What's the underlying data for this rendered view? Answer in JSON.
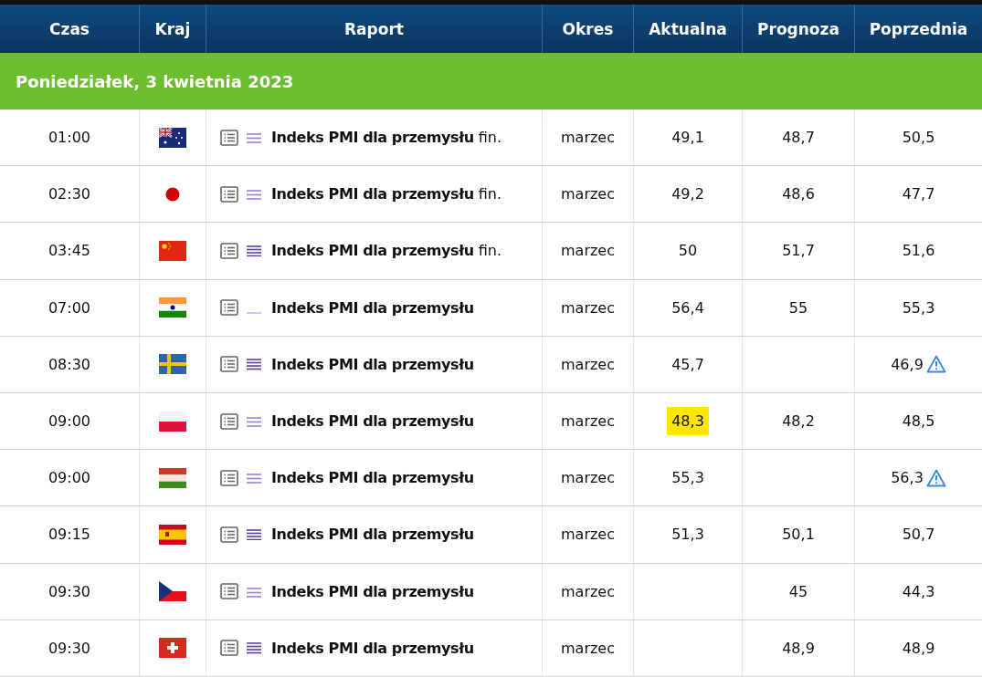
{
  "columns": [
    "Czas",
    "Kraj",
    "Raport",
    "Okres",
    "Aktualna",
    "Prognoza",
    "Poprzednia"
  ],
  "day_header": "Poniedziałek, 3 kwietnia 2023",
  "rows": [
    {
      "time": "01:00",
      "flag": {
        "kind": "australia"
      },
      "importance": {
        "kind": "medium"
      },
      "title": "Indeks PMI dla przemysłu",
      "suffix": "fin.",
      "period": "marzec",
      "actual": "49,1",
      "highlighted": false,
      "forecast": "48,7",
      "previous": "50,5",
      "revised": false
    },
    {
      "time": "02:30",
      "flag": {
        "kind": "japan"
      },
      "importance": {
        "kind": "medium"
      },
      "title": "Indeks PMI dla przemysłu",
      "suffix": "fin.",
      "period": "marzec",
      "actual": "49,2",
      "highlighted": false,
      "forecast": "48,6",
      "previous": "47,7",
      "revised": false
    },
    {
      "time": "03:45",
      "flag": {
        "kind": "china"
      },
      "importance": {
        "kind": "high"
      },
      "title": "Indeks PMI dla przemysłu",
      "suffix": "fin.",
      "period": "marzec",
      "actual": "50",
      "highlighted": false,
      "forecast": "51,7",
      "previous": "51,6",
      "revised": false
    },
    {
      "time": "07:00",
      "flag": {
        "kind": "india"
      },
      "importance": {
        "kind": "low"
      },
      "title": "Indeks PMI dla przemysłu",
      "period": "marzec",
      "actual": "56,4",
      "highlighted": false,
      "forecast": "55",
      "previous": "55,3",
      "revised": false
    },
    {
      "time": "08:30",
      "flag": {
        "kind": "sweden"
      },
      "importance": {
        "kind": "high"
      },
      "title": "Indeks PMI dla przemysłu",
      "period": "marzec",
      "actual": "45,7",
      "highlighted": false,
      "previous": "46,9",
      "revised": true
    },
    {
      "time": "09:00",
      "flag": {
        "kind": "poland"
      },
      "importance": {
        "kind": "medium"
      },
      "title": "Indeks PMI dla przemysłu",
      "period": "marzec",
      "actual": "48,3",
      "highlighted": true,
      "forecast": "48,2",
      "previous": "48,5",
      "revised": false
    },
    {
      "time": "09:00",
      "flag": {
        "kind": "hungary"
      },
      "importance": {
        "kind": "medium"
      },
      "title": "Indeks PMI dla przemysłu",
      "period": "marzec",
      "actual": "55,3",
      "highlighted": false,
      "previous": "56,3",
      "revised": true
    },
    {
      "time": "09:15",
      "flag": {
        "kind": "spain"
      },
      "importance": {
        "kind": "high"
      },
      "title": "Indeks PMI dla przemysłu",
      "period": "marzec",
      "actual": "51,3",
      "highlighted": false,
      "forecast": "50,1",
      "previous": "50,7",
      "revised": false
    },
    {
      "time": "09:30",
      "flag": {
        "kind": "czechia"
      },
      "importance": {
        "kind": "medium"
      },
      "title": "Indeks PMI dla przemysłu",
      "period": "marzec",
      "forecast": "45",
      "previous": "44,3",
      "revised": false
    },
    {
      "time": "09:30",
      "flag": {
        "kind": "switzerland"
      },
      "importance": {
        "kind": "high"
      },
      "title": "Indeks PMI dla przemysłu",
      "period": "marzec",
      "forecast": "48,9",
      "previous": "48,9",
      "revised": false
    }
  ]
}
